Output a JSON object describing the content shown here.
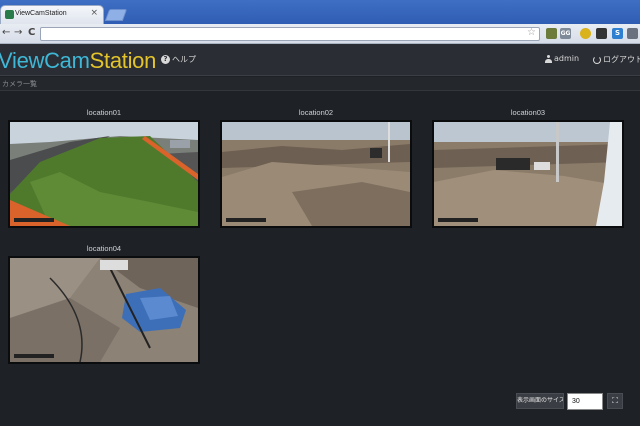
{
  "browser": {
    "tab_title": "ViewCamStation",
    "tab_close": "×",
    "back": "←",
    "forward": "→",
    "reload": "C",
    "star": "☆",
    "ext_gg": "GG",
    "ext_s": "S"
  },
  "app": {
    "logo_part1": "ViewCam",
    "logo_part2": "Station",
    "help_label": "ヘルプ",
    "user_label": "admin",
    "logout_label": "ログアウト",
    "breadcrumb": "カメラ一覧"
  },
  "cameras": [
    {
      "label": "location01"
    },
    {
      "label": "location02"
    },
    {
      "label": "location03"
    },
    {
      "label": "location04"
    }
  ],
  "footer": {
    "size_label": "表示画面のサイズ",
    "size_value": "30",
    "fullscreen_glyph": "⛶"
  },
  "colors": {
    "logo_primary": "#3fb7d6",
    "logo_accent": "#e3c42a",
    "background": "#1e2126"
  }
}
